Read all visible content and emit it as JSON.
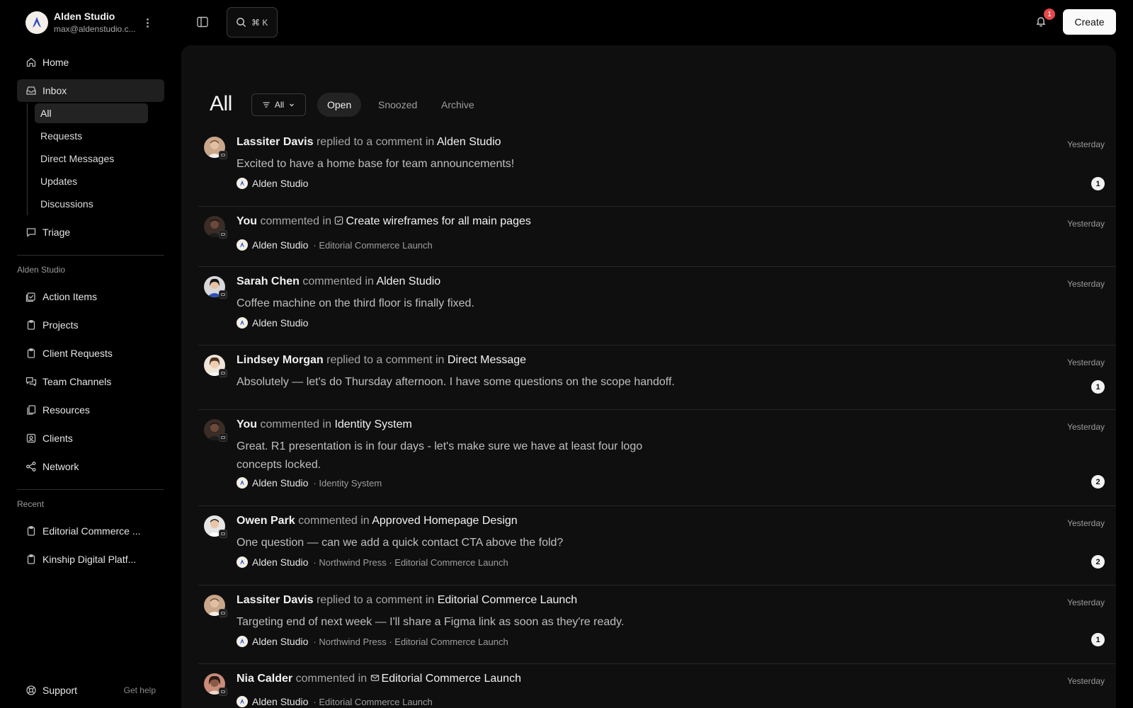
{
  "workspace": {
    "name": "Alden Studio",
    "email": "max@aldenstudio.c...",
    "logo_icon": "alden-studio-logo"
  },
  "sidebar": {
    "nav": [
      {
        "label": "Home",
        "icon": "home-icon"
      },
      {
        "label": "Inbox",
        "icon": "inbox-icon",
        "active": true
      },
      {
        "label": "Triage",
        "icon": "triage-icon"
      }
    ],
    "inbox_sub": [
      {
        "label": "All",
        "active": true
      },
      {
        "label": "Requests"
      },
      {
        "label": "Direct Messages"
      },
      {
        "label": "Updates"
      },
      {
        "label": "Discussions"
      }
    ],
    "section_label": "Alden Studio",
    "section_items": [
      {
        "label": "Action Items",
        "icon": "checklist-icon"
      },
      {
        "label": "Projects",
        "icon": "clipboard-icon"
      },
      {
        "label": "Client Requests",
        "icon": "clipboard-icon"
      },
      {
        "label": "Team Channels",
        "icon": "chat-icon"
      },
      {
        "label": "Resources",
        "icon": "files-icon"
      },
      {
        "label": "Clients",
        "icon": "contact-icon"
      },
      {
        "label": "Network",
        "icon": "network-icon"
      }
    ],
    "recent_label": "Recent",
    "recent_items": [
      {
        "label": "Editorial Commerce ...",
        "icon": "clipboard-icon"
      },
      {
        "label": "Kinship Digital Platf...",
        "icon": "clipboard-icon"
      }
    ],
    "support_label": "Support",
    "get_help_label": "Get help"
  },
  "topbar": {
    "search_shortcut": "⌘ K",
    "notification_count": "1",
    "create_label": "Create"
  },
  "main": {
    "title": "All",
    "filter_label": "All",
    "tabs": [
      {
        "label": "Open",
        "active": true
      },
      {
        "label": "Snoozed"
      },
      {
        "label": "Archive"
      }
    ]
  },
  "feed": [
    {
      "who": "Lassiter Davis",
      "action": "replied to a comment in",
      "target": "Alden Studio",
      "when": "Yesterday",
      "message": "Excited to have a home base for team announcements!",
      "workspace": "Alden Studio",
      "crumb": "",
      "count": "1"
    },
    {
      "who": "You",
      "action": "commented in",
      "target": "Create wireframes for all main pages",
      "target_icon": "task-check-icon",
      "when": "Yesterday",
      "message": "",
      "workspace": "Alden Studio",
      "crumb": "· Editorial Commerce Launch",
      "count": ""
    },
    {
      "who": "Sarah Chen",
      "action": "commented in",
      "target": "Alden Studio",
      "when": "Yesterday",
      "message": "Coffee machine on the third floor is finally fixed.",
      "workspace": "Alden Studio",
      "crumb": "",
      "count": ""
    },
    {
      "who": "Lindsey Morgan",
      "action": "replied to a comment in",
      "target": "Direct Message",
      "when": "Yesterday",
      "message": "Absolutely — let's do Thursday afternoon. I have some questions on the scope handoff.",
      "workspace": "",
      "crumb": "",
      "count": "1"
    },
    {
      "who": "You",
      "action": "commented in",
      "target": "Identity System",
      "when": "Yesterday",
      "message": "Great. R1 presentation is in four days - let's make sure we have at least four logo concepts locked.",
      "workspace": "Alden Studio",
      "crumb": "· Identity System",
      "count": "2"
    },
    {
      "who": "Owen Park",
      "action": "commented in",
      "target": "Approved Homepage Design",
      "when": "Yesterday",
      "message": "One question — can we add a quick contact CTA above the fold?",
      "workspace": "Alden Studio",
      "crumb": "· Northwind Press · Editorial Commerce Launch",
      "count": "2"
    },
    {
      "who": "Lassiter Davis",
      "action": "replied to a comment in",
      "target": "Editorial Commerce Launch",
      "when": "Yesterday",
      "message": "Targeting end of next week — I'll share a Figma link as soon as they're ready.",
      "workspace": "Alden Studio",
      "crumb": "· Northwind Press · Editorial Commerce Launch",
      "count": "1"
    },
    {
      "who": "Nia Calder",
      "action": "commented in",
      "target": "Editorial Commerce Launch",
      "target_icon": "mail-icon",
      "when": "Yesterday",
      "message": "",
      "workspace": "Alden Studio",
      "crumb": "· Editorial Commerce Launch",
      "count": ""
    }
  ],
  "colors": {
    "background": "#000000",
    "panel": "#0f0f0f",
    "badge": "#e5484d"
  }
}
